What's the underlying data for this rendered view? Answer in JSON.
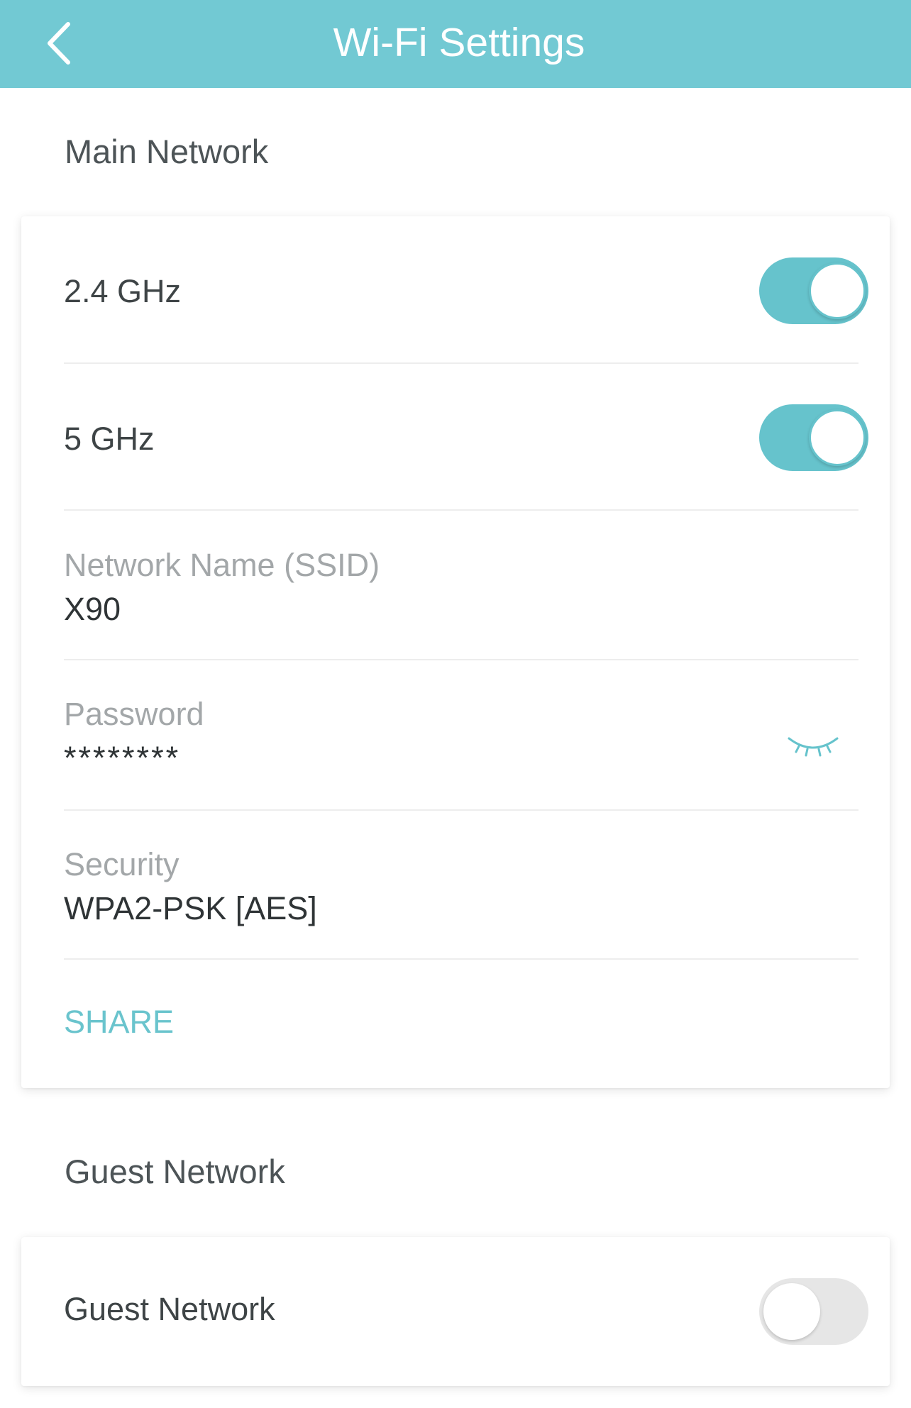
{
  "header": {
    "title": "Wi-Fi Settings",
    "back_icon": "chevron-left-icon"
  },
  "main_network": {
    "section_title": "Main Network",
    "band_24": {
      "label": "2.4 GHz",
      "enabled": true
    },
    "band_5": {
      "label": "5 GHz",
      "enabled": true
    },
    "ssid": {
      "label": "Network Name (SSID)",
      "value": "X90"
    },
    "password": {
      "label": "Password",
      "value": "********",
      "toggle_icon": "eye-closed-icon"
    },
    "security": {
      "label": "Security",
      "value": "WPA2-PSK [AES]"
    },
    "share_label": "SHARE"
  },
  "guest_network": {
    "section_title": "Guest Network",
    "toggle": {
      "label": "Guest Network",
      "enabled": false
    }
  },
  "colors": {
    "accent": "#72c9d3",
    "toggle_on": "#66c3cc",
    "toggle_off": "#e6e6e6"
  }
}
